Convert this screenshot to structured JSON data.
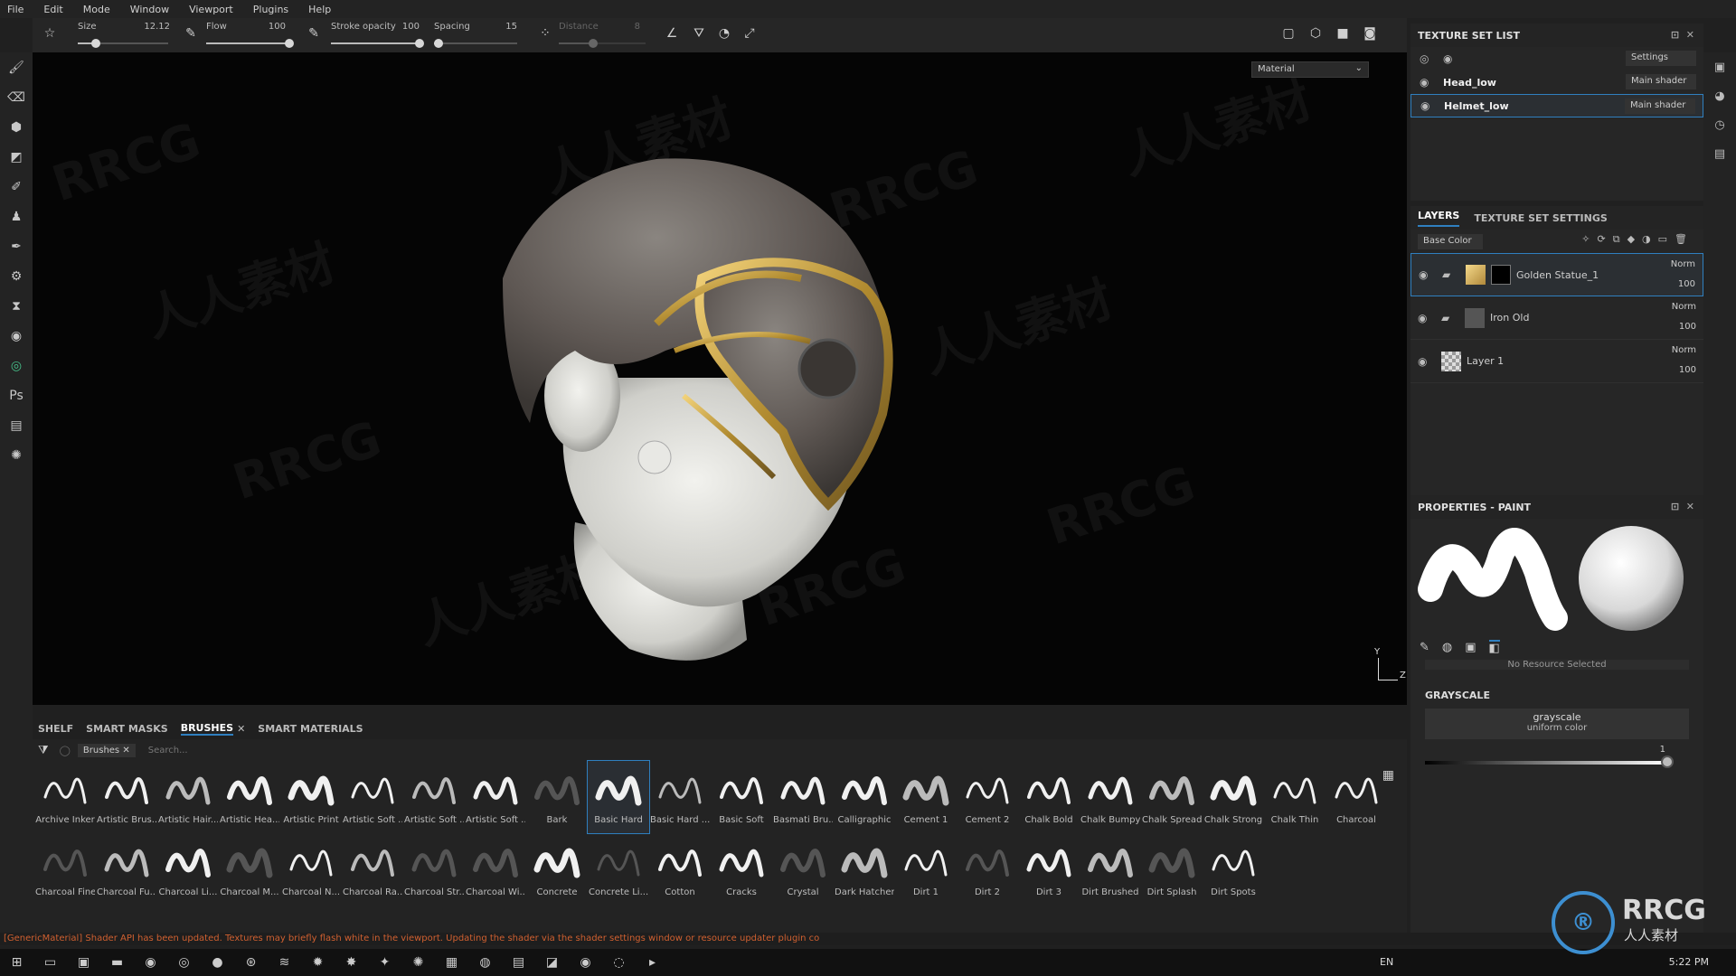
{
  "menu": [
    "File",
    "Edit",
    "Mode",
    "Window",
    "Viewport",
    "Plugins",
    "Help"
  ],
  "toolbar": {
    "size_label": "Size",
    "size_value": "12.12",
    "flow_label": "Flow",
    "flow_value": "100",
    "stroke_label": "Stroke opacity",
    "stroke_value": "100",
    "spacing_label": "Spacing",
    "spacing_value": "15",
    "distance_label": "Distance",
    "distance_value": "8",
    "size_level": 0.2,
    "flow_level": 1.0,
    "stroke_level": 1.0,
    "spacing_level": 0.05,
    "distance_level": 0.4
  },
  "viewport": {
    "mode_select": "Material",
    "axis_y": "Y",
    "axis_z": "Z"
  },
  "watermarks": [
    "RRCG",
    "人人素材"
  ],
  "texture_set_list": {
    "title": "TEXTURE SET LIST",
    "settings_label": "Settings",
    "items": [
      {
        "name": "Head_low",
        "shader": "Main shader"
      },
      {
        "name": "Helmet_low",
        "shader": "Main shader"
      }
    ]
  },
  "layers_panel": {
    "tab_layers": "LAYERS",
    "tab_settings": "TEXTURE SET SETTINGS",
    "channel": "Base Color",
    "layers": [
      {
        "name": "Golden Statue_1",
        "blend": "Norm",
        "opacity": "100"
      },
      {
        "name": "Iron Old",
        "blend": "Norm",
        "opacity": "100"
      },
      {
        "name": "Layer 1",
        "blend": "Norm",
        "opacity": "100"
      }
    ]
  },
  "properties": {
    "title": "PROPERTIES - PAINT",
    "no_resource": "No Resource Selected",
    "section": "GRAYSCALE",
    "gs_title": "grayscale",
    "gs_sub": "uniform color",
    "value": "1",
    "value_level": 1.0
  },
  "shelf": {
    "tabs": [
      "SHELF",
      "SMART MASKS",
      "BRUSHES",
      "SMART MATERIALS"
    ],
    "filter_chip": "Brushes",
    "search_placeholder": "Search...",
    "row1": [
      "Archive Inker",
      "Artistic Brus...",
      "Artistic Hair...",
      "Artistic Hea...",
      "Artistic Print",
      "Artistic Soft ...",
      "Artistic Soft ...",
      "Artistic Soft ...",
      "Bark",
      "Basic Hard",
      "Basic Hard ...",
      "Basic Soft",
      "Basmati Bru...",
      "Calligraphic",
      "Cement 1",
      "Cement 2",
      "Chalk Bold",
      "Chalk Bumpy",
      "Chalk Spread",
      "Chalk Strong",
      "Chalk Thin"
    ],
    "row2": [
      "Charcoal",
      "Charcoal Fine",
      "Charcoal Fu...",
      "Charcoal Li...",
      "Charcoal M...",
      "Charcoal N...",
      "Charcoal Ra...",
      "Charcoal Str...",
      "Charcoal Wi...",
      "Concrete",
      "Concrete Li...",
      "Cotton",
      "Cracks",
      "Crystal",
      "Dark Hatcher",
      "Dirt 1",
      "Dirt 2",
      "Dirt 3",
      "Dirt Brushed",
      "Dirt Splash",
      "Dirt Spots"
    ],
    "selected": "Basic Hard"
  },
  "status_message": "[GenericMaterial] Shader API has been updated. Textures may briefly flash white in the viewport. Updating the shader via the shader settings window or resource updater plugin co",
  "taskbar": {
    "lang": "EN",
    "time": "5:22 PM"
  },
  "logo": {
    "text": "RRCG",
    "sub": "人人素材"
  },
  "colors": {
    "accent": "#2f7fbf",
    "status": "#d06030"
  }
}
